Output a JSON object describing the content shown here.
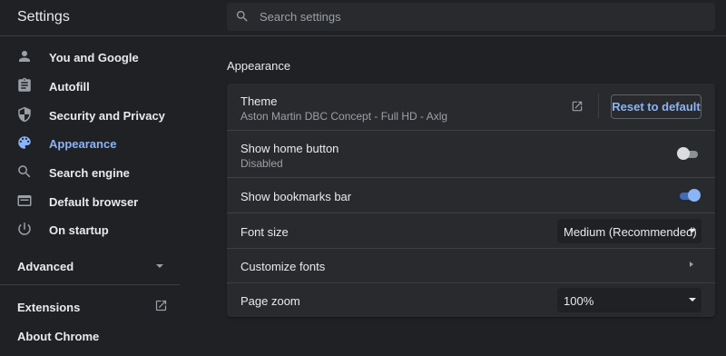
{
  "app": {
    "title": "Settings"
  },
  "search": {
    "placeholder": "Search settings",
    "icon": "search-icon"
  },
  "sidebar": {
    "items": [
      {
        "label": "You and Google",
        "icon": "person-icon"
      },
      {
        "label": "Autofill",
        "icon": "clipboard-icon"
      },
      {
        "label": "Security and Privacy",
        "icon": "shield-icon"
      },
      {
        "label": "Appearance",
        "icon": "palette-icon",
        "active": true
      },
      {
        "label": "Search engine",
        "icon": "search-icon"
      },
      {
        "label": "Default browser",
        "icon": "browser-icon"
      },
      {
        "label": "On startup",
        "icon": "power-icon"
      }
    ],
    "advanced": {
      "label": "Advanced"
    },
    "extensions": {
      "label": "Extensions",
      "icon": "open-in-new-icon"
    },
    "about": {
      "label": "About Chrome"
    }
  },
  "appearance": {
    "section_title": "Appearance",
    "theme": {
      "label": "Theme",
      "value": "Aston Martin DBC Concept - Full HD - Axlg",
      "reset_label": "Reset to default"
    },
    "home_button": {
      "label": "Show home button",
      "status": "Disabled",
      "enabled": false
    },
    "bookmarks_bar": {
      "label": "Show bookmarks bar",
      "enabled": true
    },
    "font_size": {
      "label": "Font size",
      "value": "Medium (Recommended)"
    },
    "customize_fonts": {
      "label": "Customize fonts"
    },
    "page_zoom": {
      "label": "Page zoom",
      "value": "100%"
    }
  },
  "colors": {
    "accent": "#8ab4f8",
    "background": "#202124",
    "card": "#292a2d"
  }
}
